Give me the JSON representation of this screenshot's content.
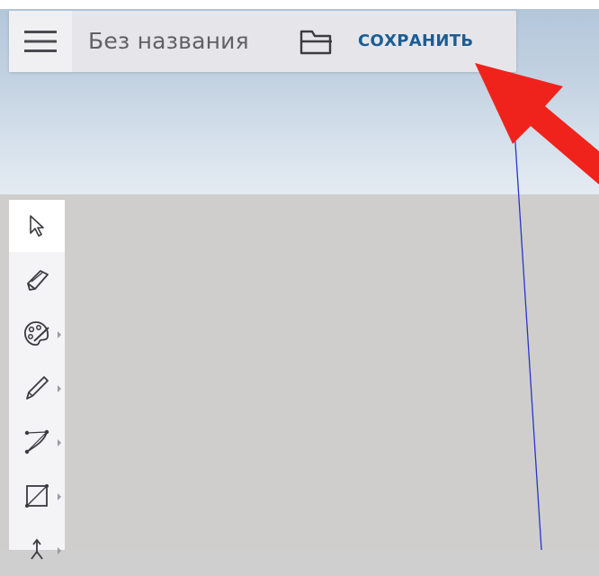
{
  "app": {
    "document_title": "Без названия",
    "save_label": "СОХРАНИТЬ"
  },
  "icons": {
    "menu": "hamburger-menu-icon",
    "open": "folder-open-icon"
  },
  "tools": [
    {
      "name": "select",
      "icon": "cursor-arrow-icon",
      "active": true,
      "has_submenu": false
    },
    {
      "name": "eraser",
      "icon": "eraser-icon",
      "active": false,
      "has_submenu": false
    },
    {
      "name": "paint",
      "icon": "palette-icon",
      "active": false,
      "has_submenu": true
    },
    {
      "name": "pencil",
      "icon": "pencil-icon",
      "active": false,
      "has_submenu": true
    },
    {
      "name": "arc",
      "icon": "arc-icon",
      "active": false,
      "has_submenu": true
    },
    {
      "name": "rectangle",
      "icon": "rectangle-icon",
      "active": false,
      "has_submenu": true
    },
    {
      "name": "push-pull",
      "icon": "push-pull-icon",
      "active": false,
      "has_submenu": true
    }
  ],
  "colors": {
    "toolbar_bg": "#e6e6ea",
    "save_text": "#1b5d94",
    "sky_top": "#b3c6da",
    "ground": "#cfcecd",
    "blue_axis": "#2a35c8",
    "annotation_arrow": "#f0231c"
  }
}
